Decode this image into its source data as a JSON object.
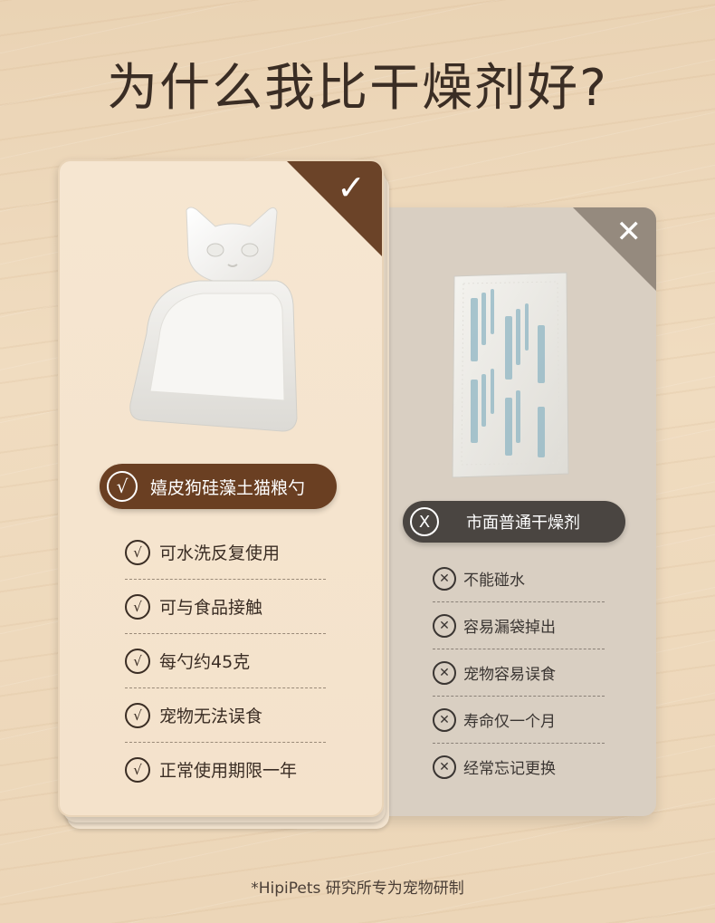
{
  "title": "为什么我比干燥剂好?",
  "left_card": {
    "corner_icon": "checkmark-icon",
    "corner_symbol": "✓",
    "product_image": "cat-shaped-scoop",
    "pill_symbol": "√",
    "pill_label": "嬉皮狗硅藻土猫粮勺",
    "features": [
      {
        "symbol": "√",
        "label": "可水洗反复使用"
      },
      {
        "symbol": "√",
        "label": "可与食品接触"
      },
      {
        "symbol": "√",
        "label": "每勺约45克"
      },
      {
        "symbol": "√",
        "label": "宠物无法误食"
      },
      {
        "symbol": "√",
        "label": "正常使用期限一年"
      }
    ],
    "colors": {
      "accent": "#6a3f22",
      "background": "#f6e6d1"
    }
  },
  "right_card": {
    "corner_icon": "close-icon",
    "corner_symbol": "✕",
    "product_image": "desiccant-packet",
    "pill_symbol": "X",
    "pill_label": "市面普通干燥剂",
    "features": [
      {
        "symbol": "✕",
        "label": "不能碰水"
      },
      {
        "symbol": "✕",
        "label": "容易漏袋掉出"
      },
      {
        "symbol": "✕",
        "label": "宠物容易误食"
      },
      {
        "symbol": "✕",
        "label": "寿命仅一个月"
      },
      {
        "symbol": "✕",
        "label": "经常忘记更换"
      }
    ],
    "colors": {
      "accent": "#4a4541",
      "background": "#d9cfc2"
    }
  },
  "footer": "*HipiPets 研究所专为宠物研制"
}
